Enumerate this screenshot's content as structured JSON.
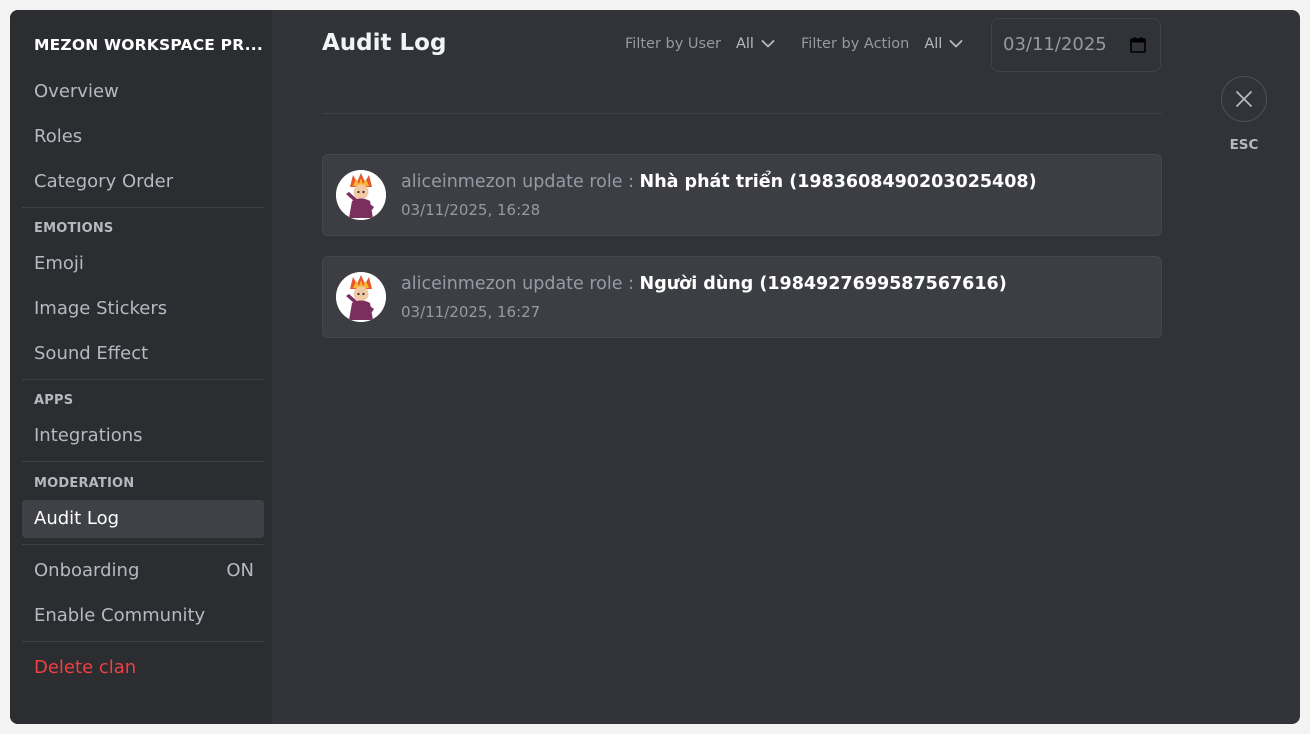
{
  "sidebar": {
    "clan_name": "MEZON WORKSPACE PR...",
    "items_top": [
      {
        "label": "Overview"
      },
      {
        "label": "Roles"
      },
      {
        "label": "Category Order"
      }
    ],
    "sections": {
      "emotions": "EMOTIONS",
      "apps": "APPS",
      "moderation": "MODERATION"
    },
    "emotions_items": [
      {
        "label": "Emoji"
      },
      {
        "label": "Image Stickers"
      },
      {
        "label": "Sound Effect"
      }
    ],
    "apps_items": [
      {
        "label": "Integrations"
      }
    ],
    "moderation_items": [
      {
        "label": "Audit Log",
        "active": true
      }
    ],
    "onboarding": {
      "label": "Onboarding",
      "badge": "ON"
    },
    "enable_community": {
      "label": "Enable Community"
    },
    "delete_clan": {
      "label": "Delete clan"
    }
  },
  "main": {
    "title": "Audit Log",
    "filter_user": {
      "label": "Filter by User",
      "value": "All"
    },
    "filter_action": {
      "label": "Filter by Action",
      "value": "All"
    },
    "date": {
      "value": "03/11/2025"
    },
    "entries": [
      {
        "actor_action": "aliceinmezon update role : ",
        "target": "Nhà phát triển (1983608490203025408)",
        "time": "03/11/2025, 16:28"
      },
      {
        "actor_action": "aliceinmezon update role : ",
        "target": "Người dùng (1984927699587567616)",
        "time": "03/11/2025, 16:27"
      }
    ]
  },
  "close": {
    "label": "ESC"
  },
  "colors": {
    "background": "#313338",
    "sidebar": "#2b2d31",
    "active_item": "#3f4147",
    "danger": "#f23f42",
    "entry_card": "#3c3e44"
  },
  "icons": {
    "chevron": "chevron-down-icon",
    "calendar": "calendar-icon",
    "close": "close-icon",
    "avatar": "avatar"
  }
}
